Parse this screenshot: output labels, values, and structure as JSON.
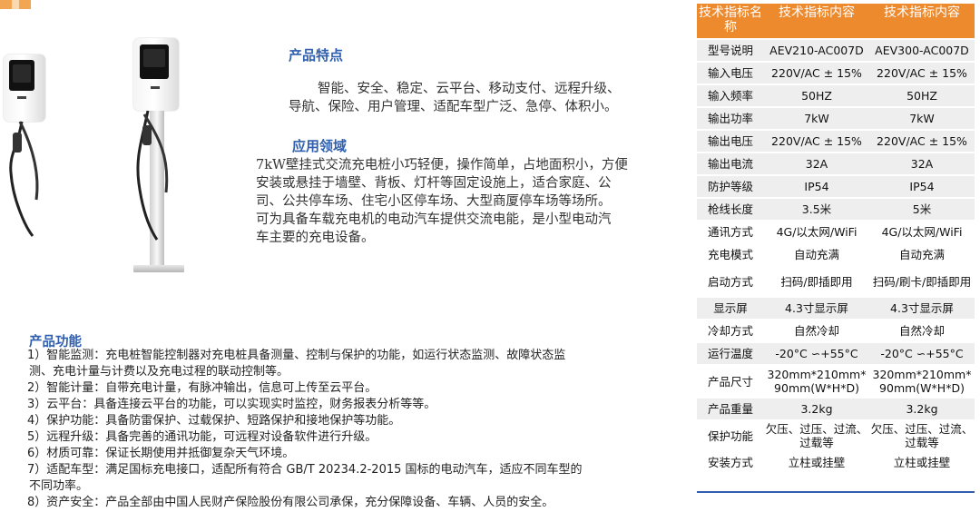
{
  "features": {
    "heading": "产品特点",
    "line1": "智能、安全、稳定、云平台、移动支付、远程升级、",
    "line2": "导航、保险、用户管理、适配车型广泛、急停、体积小。"
  },
  "application": {
    "heading": "应用领域",
    "line1": "7kW壁挂式交流充电桩小巧轻便，操作简单，占地面积小，方便",
    "line2": "安装或悬挂于墙壁、背板、灯杆等固定设施上，适合家庭、公",
    "line3": "司、公共停车场、住宅小区停车场、大型商厦停车场等场所。",
    "line4": "可为具备车载充电机的电动汽车提供交流电能，是小型电动汽",
    "line5": "车主要的充电设备。"
  },
  "functions": {
    "heading": "产品功能",
    "items": [
      "1）智能监测：充电桩智能控制器对充电桩具备测量、控制与保护的功能，如运行状态监测、故障状态监",
      "测、充电计量与计费以及充电过程的联动控制等。",
      "2）智能计量：自带充电计量，有脉冲输出，信息可上传至云平台。",
      "3）云平台：具备连接云平台的功能，可以实现实时监控，财务报表分析等等。",
      "4）保护功能：具备防雷保护、过载保护、短路保护和接地保护等功能。",
      "5）远程升级：具备完善的通讯功能，可远程对设备软件进行升级。",
      "6）材质可靠：保证长期使用并抵御复杂天气环境。",
      "7）适配车型：满足国标充电接口，适配所有符合 GB/T 20234.2-2015 国标的电动汽车，适应不同车型的",
      "不同功率。",
      "8）资产安全：产品全部由中国人民财产保险股份有限公司承保，充分保障设备、车辆、人员的安全。"
    ]
  },
  "spec_table": {
    "headers": [
      "技术指标名称",
      "技术指标内容",
      "技术指标内容"
    ],
    "rows": [
      {
        "name": "型号说明",
        "a": "AEV210-AC007D",
        "b": "AEV300-AC007D"
      },
      {
        "name": "输入电压",
        "a": "220V/AC ± 15%",
        "b": "220V/AC ± 15%"
      },
      {
        "name": "输入频率",
        "a": "50HZ",
        "b": "50HZ"
      },
      {
        "name": "输出功率",
        "a": "7kW",
        "b": "7kW"
      },
      {
        "name": "输出电压",
        "a": "220V/AC ± 15%",
        "b": "220V/AC ± 15%"
      },
      {
        "name": "输出电流",
        "a": "32A",
        "b": "32A"
      },
      {
        "name": "防护等级",
        "a": "IP54",
        "b": "IP54"
      },
      {
        "name": "枪线长度",
        "a": "3.5米",
        "b": "5米"
      },
      {
        "name": "通讯方式",
        "a": "4G/以太网/WiFi",
        "b": "4G/以太网/WiFi"
      },
      {
        "name": "充电模式",
        "a": "自动充满",
        "b": "自动充满"
      },
      {
        "name": "启动方式",
        "a": "扫码/即插即用",
        "b": "扫码/刷卡/即插即用"
      },
      {
        "name": "显示屏",
        "a": "4.3寸显示屏",
        "b": "4.3寸显示屏"
      },
      {
        "name": "冷却方式",
        "a": "自然冷却",
        "b": "自然冷却"
      },
      {
        "name": "运行温度",
        "a": "-20°C ∽+55°C",
        "b": "-20°C ∽+55°C"
      },
      {
        "name": "产品尺寸",
        "a": "320mm*210mm*90mm(W*H*D)",
        "b": "320mm*210mm*90mm(W*H*D)"
      },
      {
        "name": "产品重量",
        "a": "3.2kg",
        "b": "3.2kg"
      },
      {
        "name": "保护功能",
        "a": "欠压、过压、过流、过载等",
        "b": "欠压、过压、过流、过载等"
      },
      {
        "name": "安装方式",
        "a": "立柱或挂壁",
        "b": "立柱或挂壁"
      }
    ]
  }
}
